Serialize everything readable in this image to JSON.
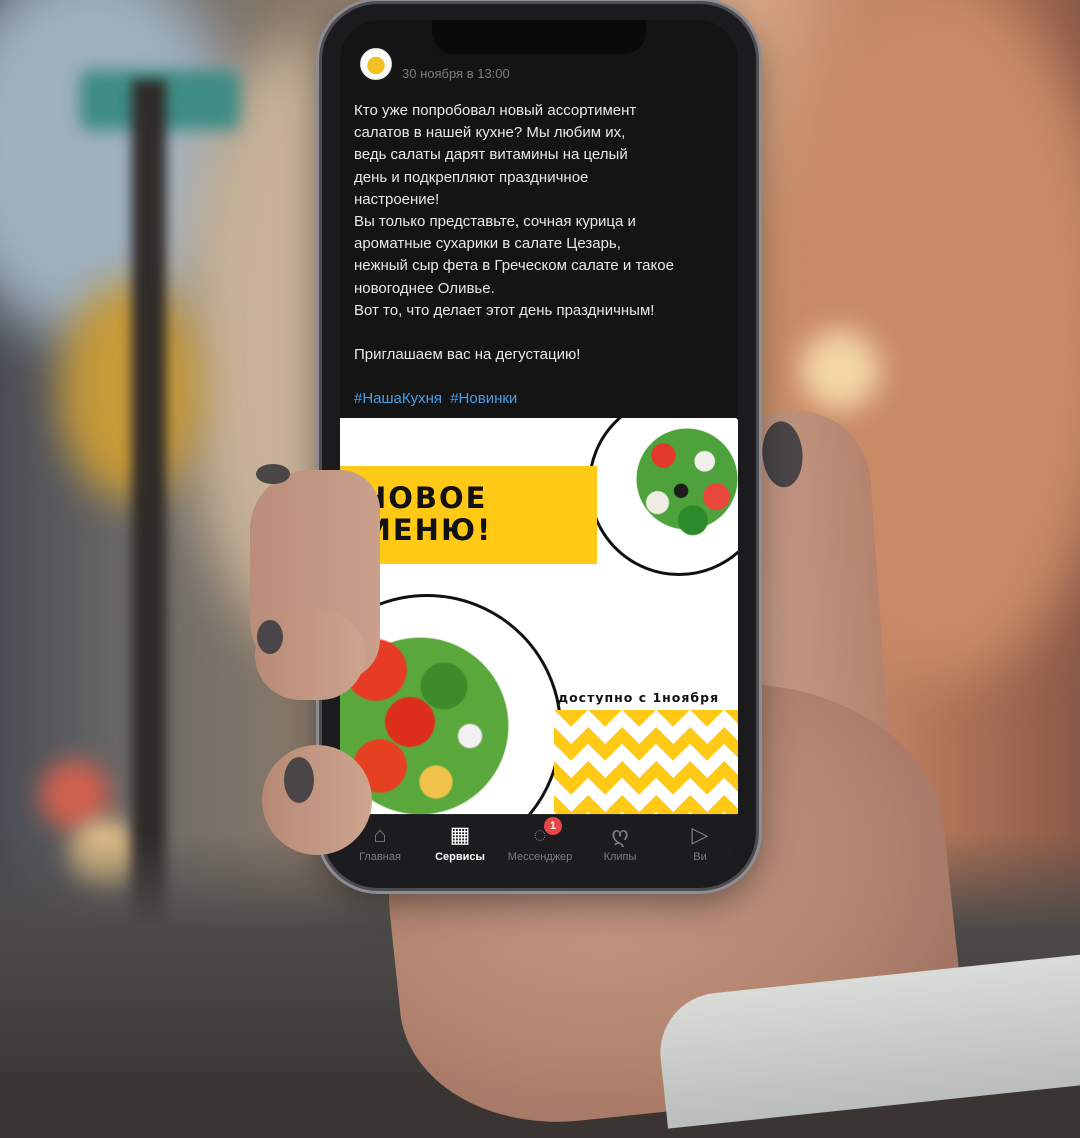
{
  "post": {
    "date": "30 ноября в 13:00",
    "lines": [
      "Кто уже попробовал новый ассортимент",
      "салатов в нашей кухне? Мы любим их,",
      "ведь салаты дарят витамины на целый",
      "день и подкрепляют праздничное",
      "настроение!",
      "Вы только представьте, сочная курица и",
      "ароматные сухарики в салате Цезарь,",
      "нежный сыр фета в Греческом салате и такое",
      "новогоднее Оливье.",
      "Вот то, что делает этот день праздничным!",
      "",
      "Приглашаем вас на дегустацию!"
    ],
    "hashtags": [
      "#НашаКухня",
      "#Новинки"
    ]
  },
  "promo": {
    "headline": "НОВОЕ\nМЕНЮ!",
    "availability": "доступно с 1ноября",
    "accent_color": "#ffc915"
  },
  "tabbar": {
    "items": [
      {
        "label": "Главная",
        "icon": "home-icon",
        "glyph": "⌂",
        "active": false
      },
      {
        "label": "Сервисы",
        "icon": "services-grid-icon",
        "glyph": "▦",
        "active": true
      },
      {
        "label": "Мессенджер",
        "icon": "message-bubble-icon",
        "glyph": "◌",
        "active": false,
        "badge": "1"
      },
      {
        "label": "Клипы",
        "icon": "clips-icon",
        "glyph": "ღ",
        "active": false
      },
      {
        "label": "Ви",
        "icon": "video-play-icon",
        "glyph": "▷",
        "active": false
      }
    ]
  },
  "colors": {
    "screen_bg": "#141414",
    "hashtag": "#4a9ee8",
    "badge": "#e64646"
  }
}
